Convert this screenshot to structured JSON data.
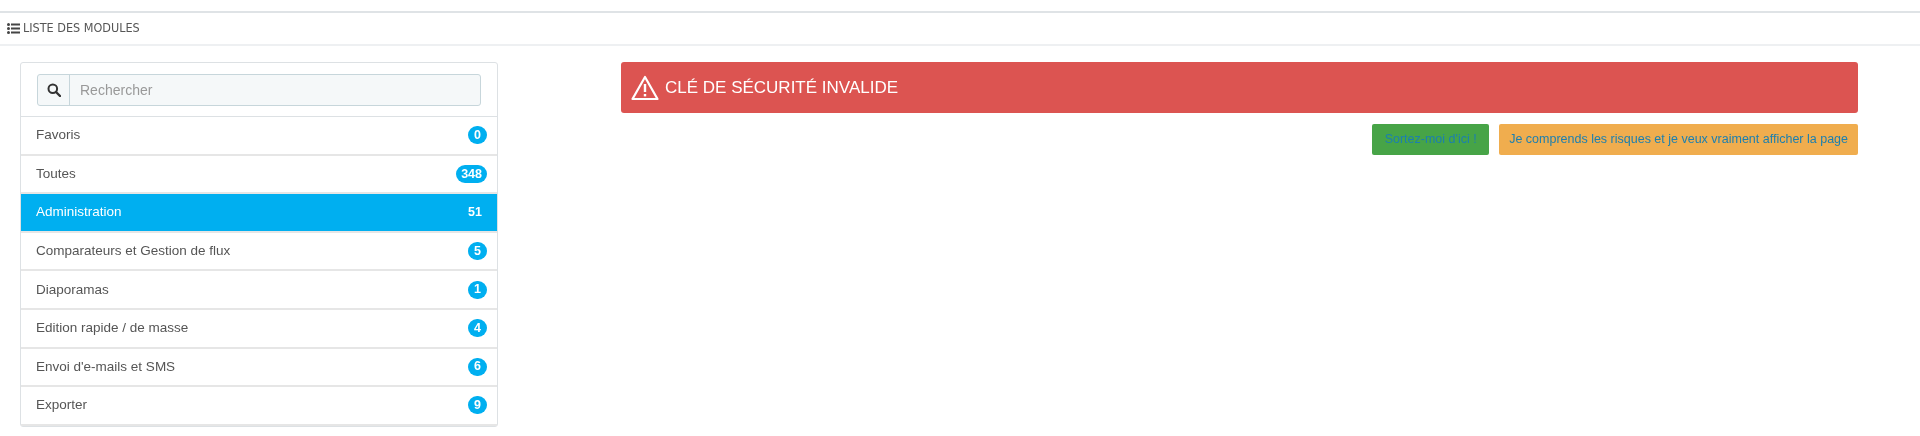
{
  "panel": {
    "title": "LISTE DES MODULES"
  },
  "search": {
    "placeholder": "Rechercher"
  },
  "categories": [
    {
      "label": "Favoris",
      "count": "0",
      "selected": false
    },
    {
      "label": "Toutes",
      "count": "348",
      "selected": false
    },
    {
      "label": "Administration",
      "count": "51",
      "selected": true
    },
    {
      "label": "Comparateurs et Gestion de flux",
      "count": "5",
      "selected": false
    },
    {
      "label": "Diaporamas",
      "count": "1",
      "selected": false
    },
    {
      "label": "Edition rapide / de masse",
      "count": "4",
      "selected": false
    },
    {
      "label": "Envoi d'e-mails et SMS",
      "count": "6",
      "selected": false
    },
    {
      "label": "Exporter",
      "count": "9",
      "selected": false
    }
  ],
  "alert": {
    "message": "CLÉ DE SÉCURITÉ INVALIDE"
  },
  "buttons": [
    {
      "kind": "leave",
      "label": "Sortez-moi d'ici !"
    },
    {
      "kind": "proceed",
      "label": "Je comprends les risques et je veux vraiment afficher la page"
    }
  ]
}
